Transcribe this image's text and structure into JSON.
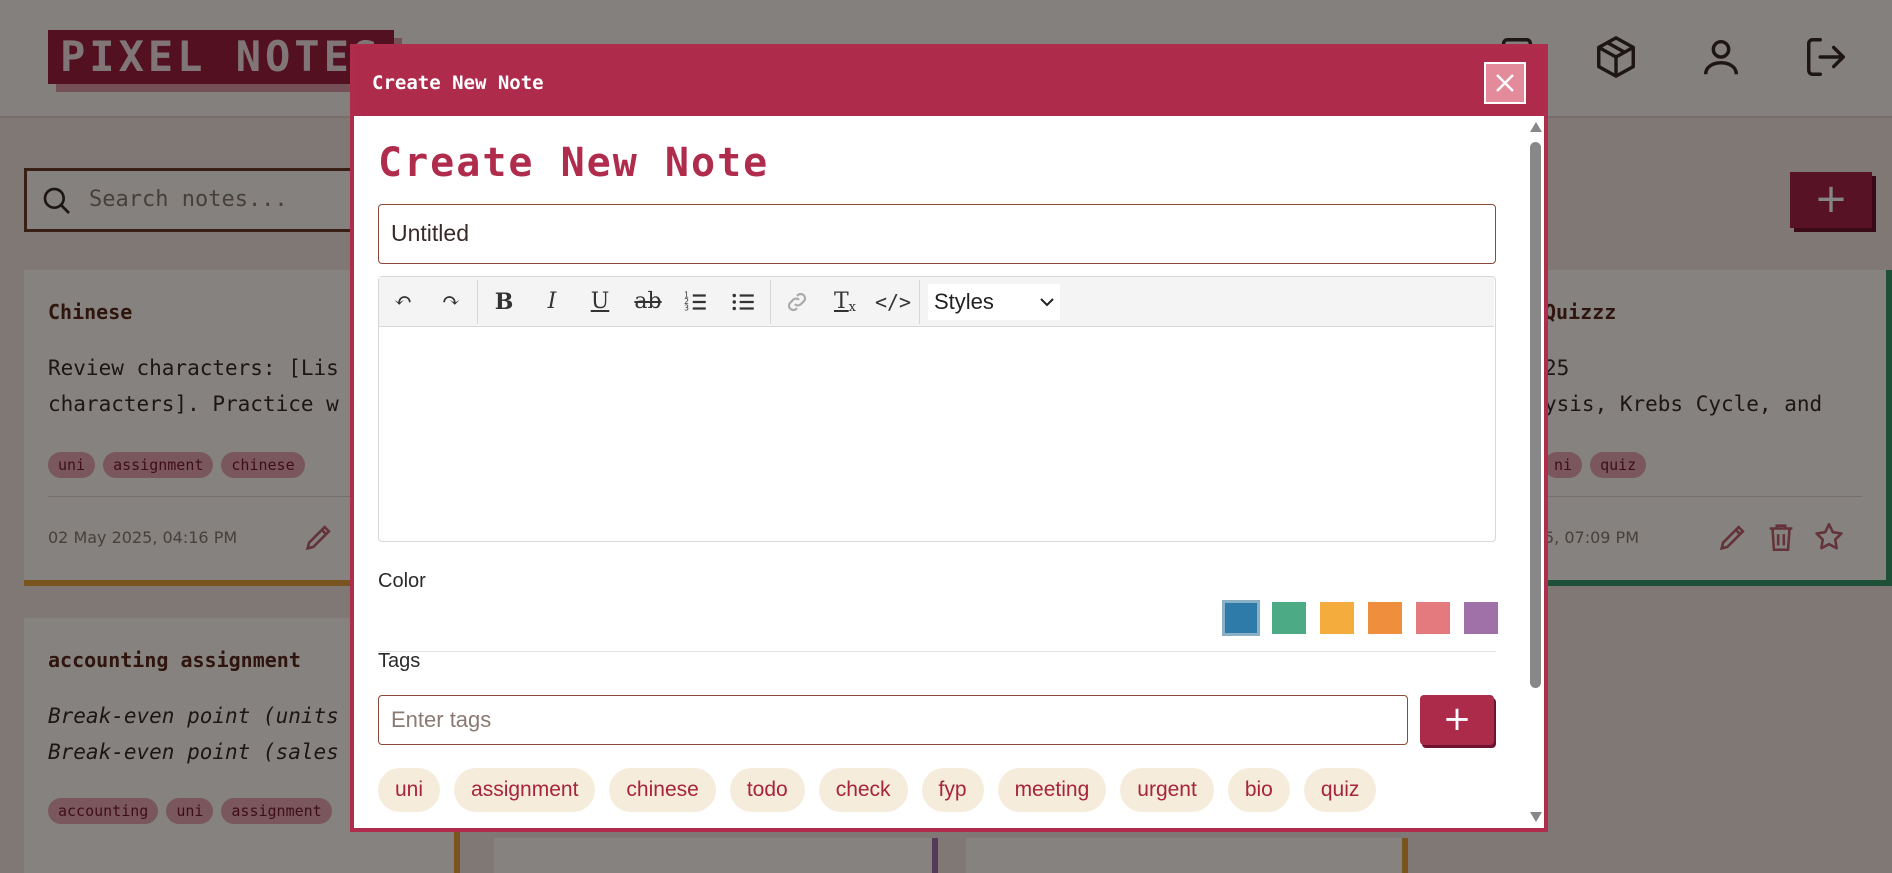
{
  "app": {
    "logo_text": "PIXEL NOTES",
    "search_placeholder": "Search notes...",
    "add_note_label": "+"
  },
  "cards": [
    {
      "title": "Chinese",
      "body": "Review characters: [Lis\ncharacters]. Practice w",
      "tags": [
        "uni",
        "assignment",
        "chinese"
      ],
      "date": "02 May 2025, 04:16 PM",
      "stripe_color": "#e8a23a"
    },
    {
      "title": "Quizzz",
      "body": "25\nysis, Krebs Cycle, and",
      "tags": [
        "ni",
        "quiz"
      ],
      "date": "5, 07:09 PM",
      "stripe_color": "#3a9a6a"
    },
    {
      "title": "accounting assignment",
      "body": "Break-even point (units\nBreak-even point (sales",
      "tags": [
        "accounting",
        "uni",
        "assignment"
      ],
      "stripe_color": "#e8a23a"
    }
  ],
  "modal": {
    "header_title": "Create New Note",
    "heading": "Create New Note",
    "title_value": "Untitled",
    "toolbar": {
      "undo": "↶",
      "redo": "↷",
      "bold": "B",
      "italic": "I",
      "underline": "U",
      "strike": "ab",
      "clear_format": "T",
      "code": "</>",
      "styles_label": "Styles"
    },
    "color_label": "Color",
    "colors": [
      "#2e7aa8",
      "#4caa84",
      "#f4ac3c",
      "#ef8e3c",
      "#e47a7e",
      "#a070a8"
    ],
    "selected_color_index": 0,
    "tags_label": "Tags",
    "tags_placeholder": "Enter tags",
    "tags_add_label": "+",
    "tag_suggestions": [
      "uni",
      "assignment",
      "chinese",
      "todo",
      "check",
      "fyp",
      "meeting",
      "urgent",
      "bio",
      "quiz"
    ]
  }
}
